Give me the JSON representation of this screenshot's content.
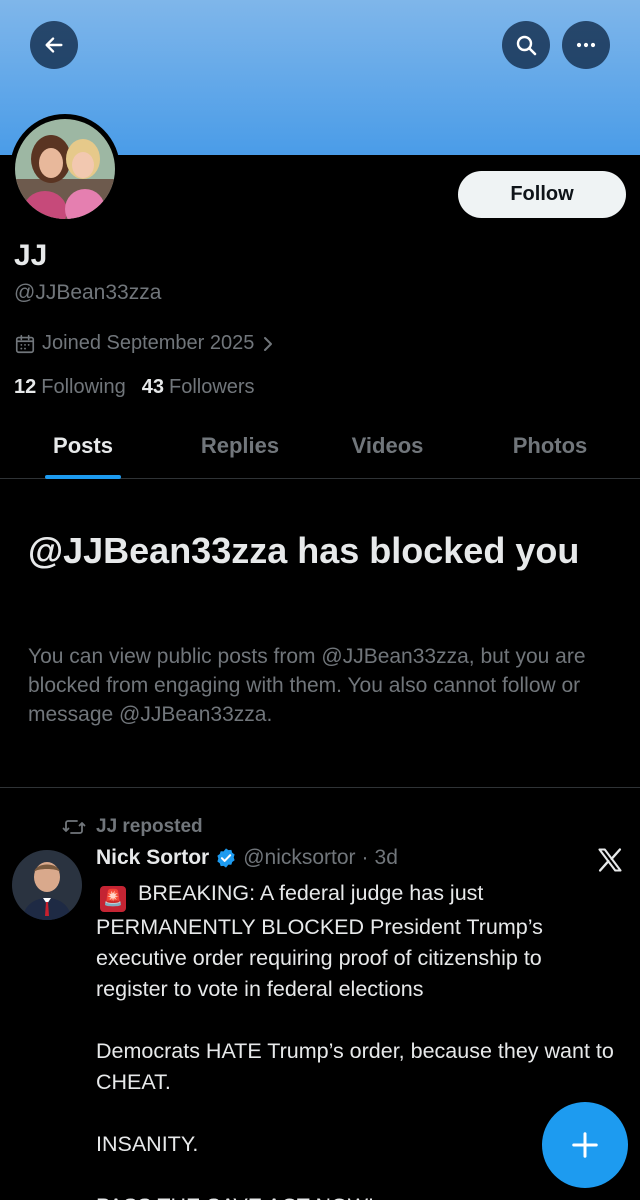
{
  "profile": {
    "display_name": "JJ",
    "handle": "@JJBean33zza",
    "joined": "Joined September 2025",
    "following_count": "12",
    "following_label": "Following",
    "followers_count": "43",
    "followers_label": "Followers",
    "follow_label": "Follow"
  },
  "tabs": [
    {
      "label": "Posts",
      "active": true
    },
    {
      "label": "Replies",
      "active": false
    },
    {
      "label": "Videos",
      "active": false
    },
    {
      "label": "Photos",
      "active": false
    }
  ],
  "blocked": {
    "title": "@JJBean33zza has blocked you",
    "description": "You can view public posts from @JJBean33zza, but you are blocked from engaging with them. You also cannot follow or message @JJBean33zza."
  },
  "post": {
    "repost_label": "JJ reposted",
    "author_name": "Nick Sortor",
    "author_handle": "@nicksortor",
    "separator": "·",
    "time": "3d",
    "siren_emoji": "🚨",
    "paragraphs": [
      "BREAKING: A federal judge has just PERMANENTLY BLOCKED President Trump’s executive order requiring proof of citizenship to register to vote in federal elections",
      "Democrats HATE Trump’s order, because they want to CHEAT.",
      "INSANITY.",
      "PASS THE SAVE ACT NOW!"
    ]
  },
  "icons": {
    "back": "arrow-left-icon",
    "search": "search-icon",
    "more": "more-icon",
    "calendar": "calendar-icon",
    "repost": "repost-icon",
    "verified": "verified-badge-icon",
    "x_logo": "x-logo-icon",
    "compose": "plus-icon"
  },
  "colors": {
    "accent": "#1d9bf0",
    "background": "#000000",
    "secondary_text": "#71767b"
  }
}
